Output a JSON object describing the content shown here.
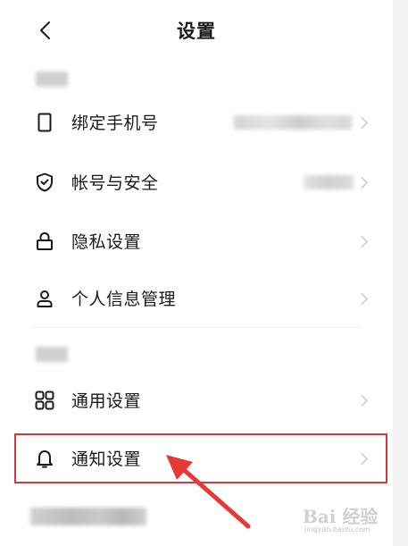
{
  "header": {
    "title": "设置"
  },
  "sections": [
    {
      "items": [
        {
          "label": "绑定手机号",
          "icon": "phone-icon"
        },
        {
          "label": "帐号与安全",
          "icon": "shield-check-icon"
        },
        {
          "label": "隐私设置",
          "icon": "lock-icon"
        },
        {
          "label": "个人信息管理",
          "icon": "person-icon"
        }
      ]
    },
    {
      "items": [
        {
          "label": "通用设置",
          "icon": "grid-icon"
        },
        {
          "label": "通知设置",
          "icon": "bell-icon",
          "highlighted": true
        }
      ]
    }
  ],
  "watermark": {
    "text": "Bai 经验",
    "url": "jingyan.baidu.com"
  },
  "colors": {
    "highlight": "#d9363e",
    "text": "#1a1a1a",
    "chevron": "#c8c8c8",
    "divider": "#efefef"
  }
}
